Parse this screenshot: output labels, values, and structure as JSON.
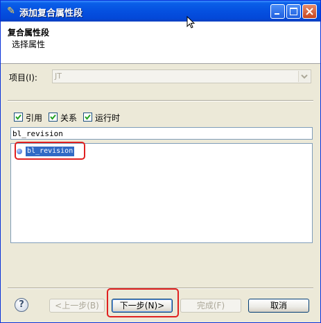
{
  "window": {
    "title": "添加复合属性段"
  },
  "header": {
    "title": "复合属性段",
    "subtitle": "选择属性"
  },
  "project": {
    "label": "项目(I):",
    "value": "JT"
  },
  "options": [
    {
      "label": "引用",
      "checked": true
    },
    {
      "label": "关系",
      "checked": true
    },
    {
      "label": "运行时",
      "checked": true
    }
  ],
  "filter": {
    "value": "bl_revision"
  },
  "tree": {
    "items": [
      {
        "label": "bl_revision",
        "selected": true
      }
    ]
  },
  "buttons": {
    "back": "<上一步(B)",
    "next": "下一步(N)>",
    "finish": "完成(F)",
    "cancel": "取消"
  },
  "colors": {
    "title_bar": "#0550E0",
    "selection": "#316AC5",
    "annotation": "#E02020"
  }
}
